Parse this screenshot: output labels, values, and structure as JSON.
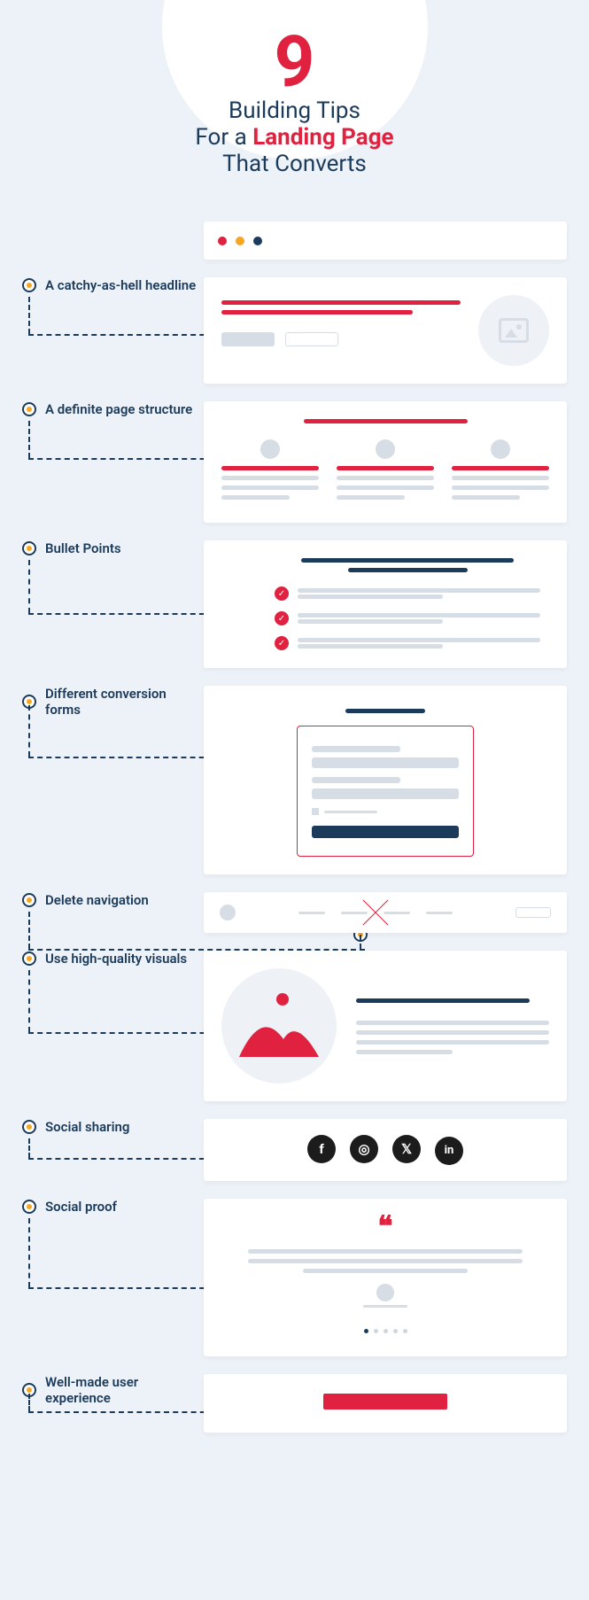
{
  "hero": {
    "number": "9",
    "line1": "Building Tips",
    "line2_pre": "For a ",
    "line2_hl": "Landing Page",
    "line3": "That Converts"
  },
  "tips": {
    "t1": "A catchy-as-hell headline",
    "t2": "A definite page structure",
    "t3": "Bullet Points",
    "t4": "Different conversion forms",
    "t5": "Delete navigation",
    "t6": "Use high-quality visuals",
    "t7": "Social sharing",
    "t8": "Social proof",
    "t9": "Well-made user experience"
  },
  "icons": {
    "facebook": "f",
    "instagram": "◎",
    "twitter": "𝕏",
    "linkedin": "in"
  },
  "glyphs": {
    "check": "✓",
    "quote": "❝"
  },
  "colors": {
    "accent": "#e0213f",
    "navy": "#1c3b5a",
    "amber": "#f6a623"
  }
}
